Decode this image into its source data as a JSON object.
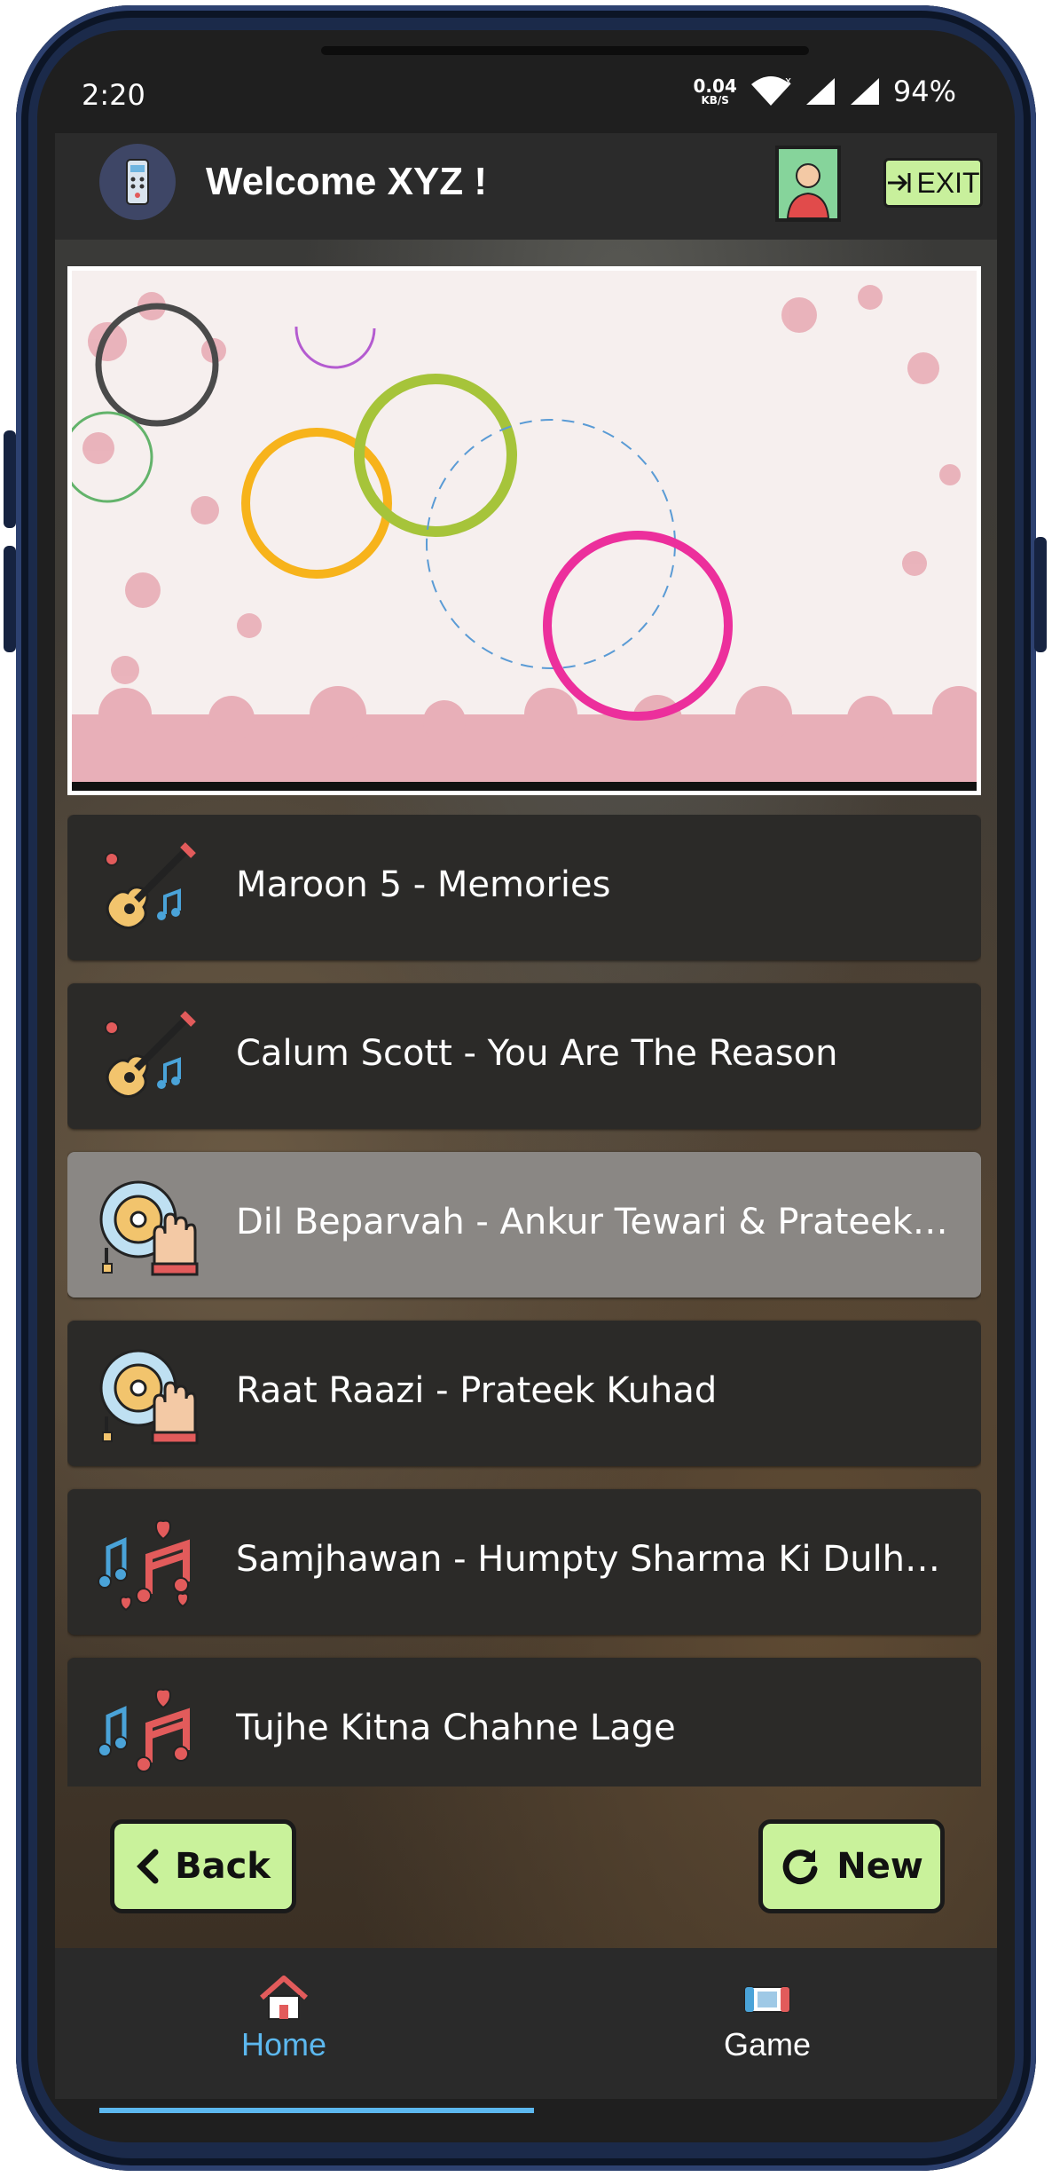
{
  "status_bar": {
    "time": "2:20",
    "speed_value": "0.04",
    "speed_unit": "KB/S",
    "battery": "94%"
  },
  "app_bar": {
    "welcome": "Welcome XYZ !",
    "exit_label": "EXIT"
  },
  "songs": [
    {
      "title": "Maroon 5 - Memories",
      "icon": "guitar-icon",
      "selected": false
    },
    {
      "title": "Calum Scott - You Are The Reason",
      "icon": "guitar-icon",
      "selected": false
    },
    {
      "title": "Dil Beparvah - Ankur Tewari & Prateek K…",
      "icon": "dj-turntable-icon",
      "selected": true
    },
    {
      "title": "Raat Raazi - Prateek Kuhad",
      "icon": "dj-turntable-icon",
      "selected": false
    },
    {
      "title": "Samjhawan - Humpty Sharma Ki Dulhania",
      "icon": "music-notes-hearts-icon",
      "selected": false
    },
    {
      "title": "Tujhe Kitna Chahne Lage",
      "icon": "music-notes-hearts-icon",
      "selected": false
    }
  ],
  "buttons": {
    "back": "Back",
    "new": "New"
  },
  "bottom_nav": {
    "home": "Home",
    "game": "Game",
    "active": "home"
  },
  "colors": {
    "accent": "#5cb8ef",
    "button_green": "#c9f29b",
    "app_bar": "#2b2b2b"
  }
}
